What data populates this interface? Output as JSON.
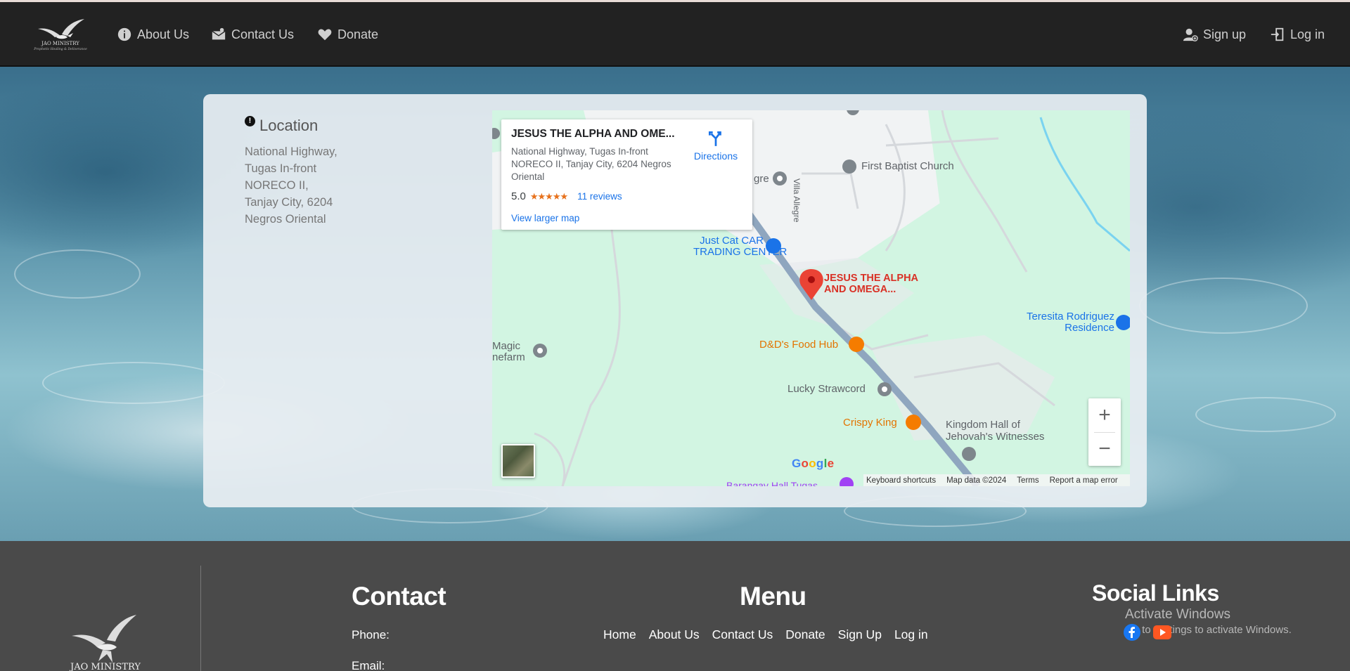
{
  "nav": {
    "about": "About Us",
    "contact": "Contact Us",
    "donate": "Donate",
    "signup": "Sign up",
    "login": "Log in"
  },
  "logo": {
    "name": "JAO MINISTRY",
    "tagline": "Prophetic Healing & Deliverance"
  },
  "location": {
    "heading": "Location",
    "address": "National Highway, Tugas In-front NORECO II, Tanjay City, 6204 Negros Oriental"
  },
  "map": {
    "place_title": "JESUS THE ALPHA AND OME...",
    "place_address": "National Highway, Tugas In-front NORECO II, Tanjay City, 6204 Negros Oriental",
    "rating": "5.0",
    "stars": "★★★★★",
    "reviews": "11 reviews",
    "larger_map": "View larger map",
    "directions": "Directions",
    "pin_label_1": "JESUS THE ALPHA",
    "pin_label_2": "AND OMEGA...",
    "labels": {
      "first_baptist": "First Baptist Church",
      "villa_allegre": "Villa Allegre",
      "allegre": "gre",
      "just_cat_1": "Just Cat CAR",
      "just_cat_2": "TRADING CENTER",
      "teresita_1": "Teresita Rodriguez",
      "teresita_2": "Residence",
      "magic_1": "Magic",
      "magic_2": "nefarm",
      "dd_food": "D&D's Food Hub",
      "lucky": "Lucky Strawcord",
      "crispy": "Crispy King",
      "kingdom_1": "Kingdom Hall of",
      "kingdom_2": "Jehovah's Witnesses",
      "barangay": "Barangay Hall Tugas"
    },
    "zoom_in": "+",
    "zoom_out": "−",
    "google": "Google",
    "attrib": {
      "shortcuts": "Keyboard shortcuts",
      "data": "Map data ©2024",
      "terms": "Terms",
      "report": "Report a map error"
    }
  },
  "footer": {
    "contact_heading": "Contact",
    "phone": "Phone:",
    "email": "Email:",
    "menu_heading": "Menu",
    "menu": [
      "Home",
      "About Us",
      "Contact Us",
      "Donate",
      "Sign Up",
      "Log in"
    ],
    "social_heading": "Social Links",
    "logo_text": "JAO MINISTRY"
  },
  "watermark": {
    "line1": "Activate Windows",
    "line2": "Go to Settings to activate Windows."
  },
  "colors": {
    "nav_bg": "#222222",
    "footer_bg": "#4a4a4a",
    "accent_blue": "#1a73e8",
    "pin_red": "#ea4335"
  }
}
